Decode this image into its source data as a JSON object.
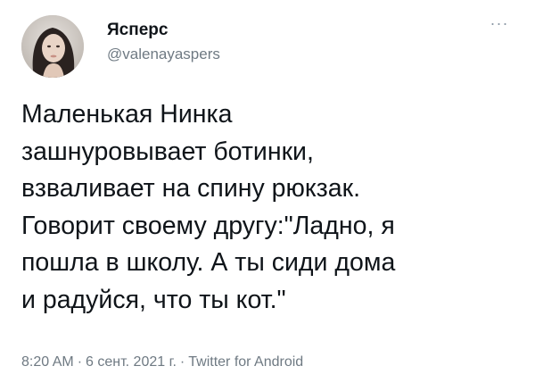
{
  "tweet": {
    "author": {
      "display_name": "Ясперс",
      "handle": "@valenayaspers"
    },
    "more_icon": "more-options-icon",
    "text": "Маленькая Нинка\nзашнуровывает ботинки,\nвзваливает на спину рюкзак.\nГоворит своему другу:\"Ладно, я\nпошла в школу. А ты сиди дома\nи радуйся, что ты кот.\"",
    "meta": {
      "time": "8:20 AM",
      "separator": "·",
      "date": "6 сент. 2021 г.",
      "source": "Twitter for Android"
    }
  }
}
